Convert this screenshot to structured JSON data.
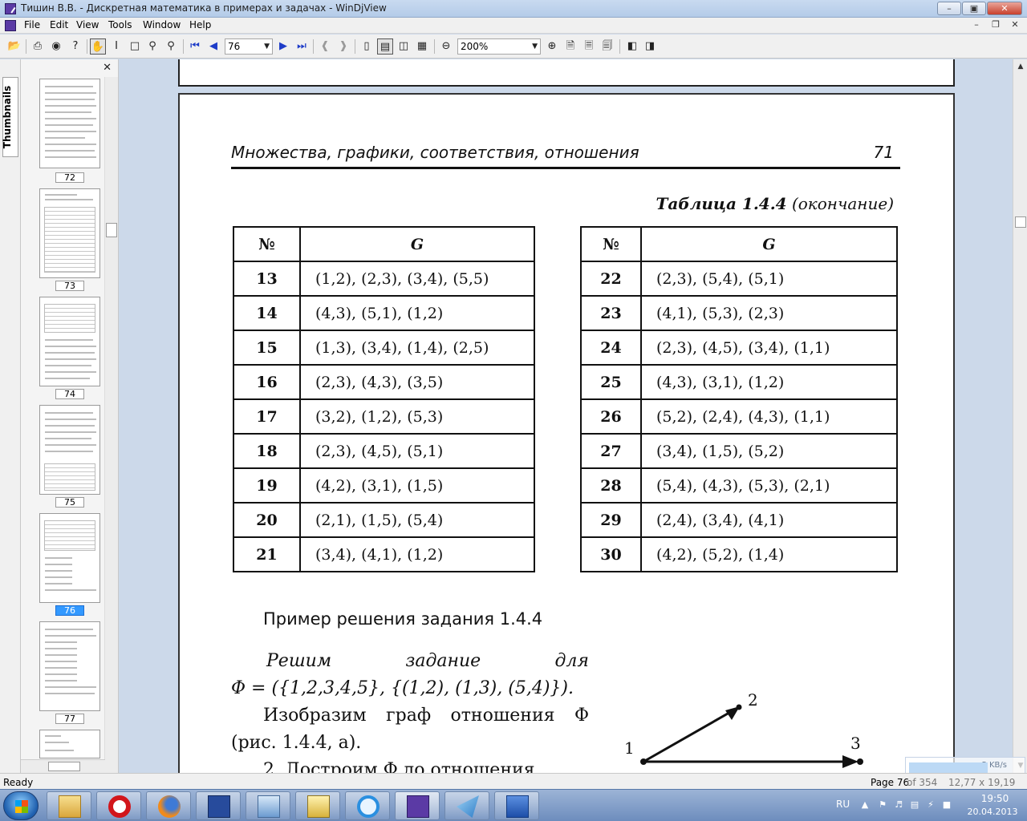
{
  "window": {
    "title": "Тишин В.В. - Дискретная математика в примерах и задачах - WinDjView"
  },
  "menu": [
    "File",
    "Edit",
    "View",
    "Tools",
    "Window",
    "Help"
  ],
  "toolbar": {
    "page_value": "76",
    "zoom_value": "200%"
  },
  "thumbnails": {
    "tab_label": "Thumbnails",
    "pages": [
      "72",
      "73",
      "74",
      "75",
      "76",
      "77"
    ],
    "selected": "76"
  },
  "page": {
    "running_head": "Множества, графики, соответствия, отношения",
    "number": "71",
    "table_caption_bold": "Таблица 1.4.4",
    "table_caption_rest": "(окончание)",
    "col_num": "№",
    "col_g": "G",
    "left_rows": [
      {
        "n": "13",
        "g": "(1,2), (2,3), (3,4), (5,5)"
      },
      {
        "n": "14",
        "g": "(4,3), (5,1), (1,2)"
      },
      {
        "n": "15",
        "g": "(1,3), (3,4), (1,4), (2,5)"
      },
      {
        "n": "16",
        "g": "(2,3), (4,3), (3,5)"
      },
      {
        "n": "17",
        "g": "(3,2), (1,2), (5,3)"
      },
      {
        "n": "18",
        "g": "(2,3), (4,5), (5,1)"
      },
      {
        "n": "19",
        "g": "(4,2), (3,1), (1,5)"
      },
      {
        "n": "20",
        "g": "(2,1), (1,5), (5,4)"
      },
      {
        "n": "21",
        "g": "(3,4), (4,1), (1,2)"
      }
    ],
    "right_rows": [
      {
        "n": "22",
        "g": "(2,3), (5,4), (5,1)"
      },
      {
        "n": "23",
        "g": "(4,1), (5,3), (2,3)"
      },
      {
        "n": "24",
        "g": "(2,3), (4,5), (3,4), (1,1)"
      },
      {
        "n": "25",
        "g": "(4,3), (3,1), (1,2)"
      },
      {
        "n": "26",
        "g": "(5,2), (2,4), (4,3), (1,1)"
      },
      {
        "n": "27",
        "g": "(3,4), (1,5), (5,2)"
      },
      {
        "n": "28",
        "g": "(5,4), (4,3), (5,3), (2,1)"
      },
      {
        "n": "29",
        "g": "(2,4), (3,4), (4,1)"
      },
      {
        "n": "30",
        "g": "(4,2), (5,2), (1,4)"
      }
    ],
    "example_title": "Пример решения задания 1.4.4",
    "para1_a": "Решим",
    "para1_b": "задание",
    "para1_c": "для",
    "para1_line2": "Φ = ({1,2,3,4,5}, {(1,2), (1,3), (5,4)}).",
    "para2": "Изобразим граф отношения Φ (рис. 1.4.4, а).",
    "para3": "2. Достроим Φ до отношения",
    "graph_labels": [
      "1",
      "2",
      "3"
    ]
  },
  "status": {
    "left": "Ready",
    "page": "Page 76",
    "of": "of 354",
    "size": "12,77 x 19,19 cm"
  },
  "netmon": {
    "speed": "5 KB/s"
  },
  "tray": {
    "lang": "RU",
    "time": "19:50",
    "date": "20.04.2013"
  }
}
